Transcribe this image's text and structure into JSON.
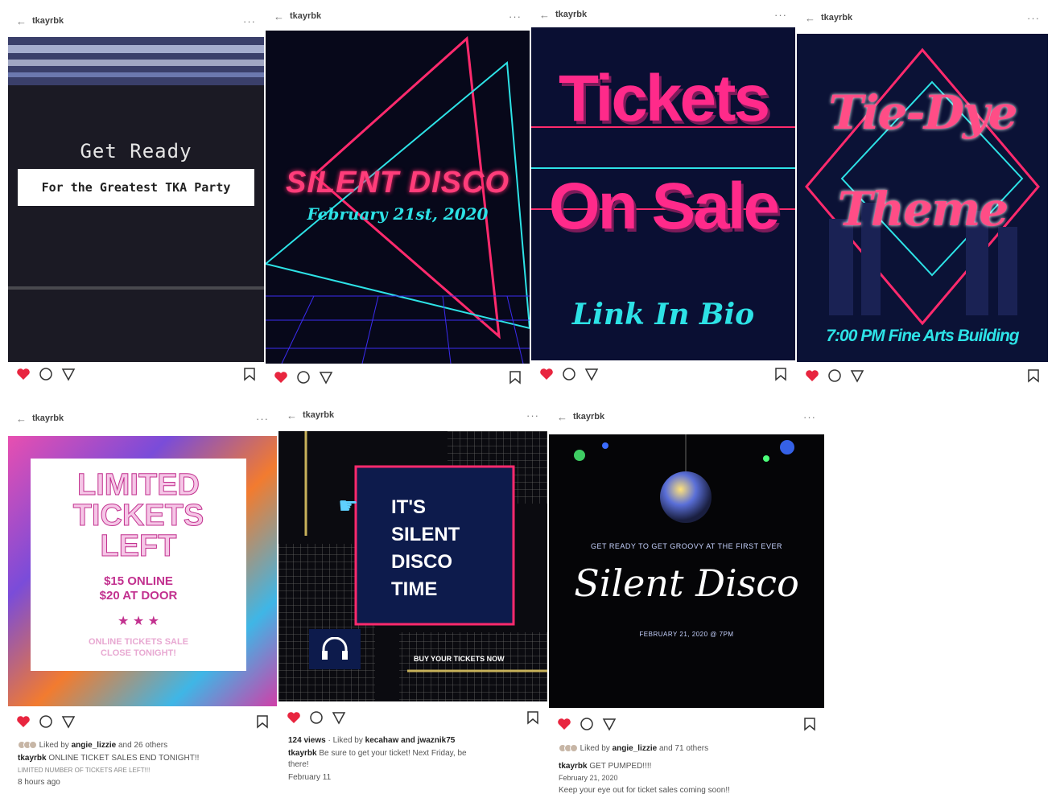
{
  "username": "tkayrbk",
  "header": {
    "back": "←",
    "more": "···"
  },
  "posts": [
    {
      "line1": "Get Ready",
      "line2": "For the Greatest TKA Party"
    },
    {
      "line1": "SILENT DISCO",
      "line2": "February 21st, 2020"
    },
    {
      "line1": "Tickets",
      "line2": "On Sale",
      "line3": "Link In Bio"
    },
    {
      "line1": "Tie-Dye",
      "line2": "Theme",
      "line3": "7:00 PM Fine Arts Building"
    },
    {
      "line1": "LIMITED",
      "line2": "TICKETS",
      "line3": "LEFT",
      "price1": "$15 ONLINE",
      "price2": "$20 AT DOOR",
      "stars": "★ ★ ★",
      "note1": "ONLINE TICKETS SALE",
      "note2": "CLOSE TONIGHT!",
      "liked_prefix": "Liked by",
      "liked_user": "angie_lizzie",
      "liked_suffix": "and 26 others",
      "caption_user": "tkayrbk",
      "caption": "ONLINE TICKET SALES END TONIGHT!!",
      "caption2": "LIMITED NUMBER OF TICKETS ARE LEFT!!!",
      "time": "8 hours ago"
    },
    {
      "line1": "IT'S",
      "line2": "SILENT",
      "line3": "DISCO",
      "line4": "TIME",
      "cta": "BUY YOUR TICKETS NOW",
      "views": "124 views",
      "liked_prefix": "Liked by",
      "liked_user": "kecahaw and jwaznik75",
      "caption_user": "tkayrbk",
      "caption": "Be sure to get your ticket! Next Friday, be",
      "caption2": "there!",
      "time": "February 11"
    },
    {
      "small_top": "GET READY TO GET GROOVY AT THE FIRST EVER",
      "script": "Silent Disco",
      "small_bottom": "FEBRUARY 21, 2020 @ 7PM",
      "liked_prefix": "Liked by",
      "liked_user": "angie_lizzie",
      "liked_suffix": "and 71 others",
      "caption_user": "tkayrbk",
      "caption": "GET PUMPED!!!!",
      "date": "February 21, 2020",
      "caption2": "Keep your eye out for ticket sales coming soon!!"
    }
  ],
  "colors": {
    "pink": "#ff2a6d",
    "cyan": "#2de2e6",
    "navy": "#0d1b4c",
    "heart": "#e8253f"
  }
}
